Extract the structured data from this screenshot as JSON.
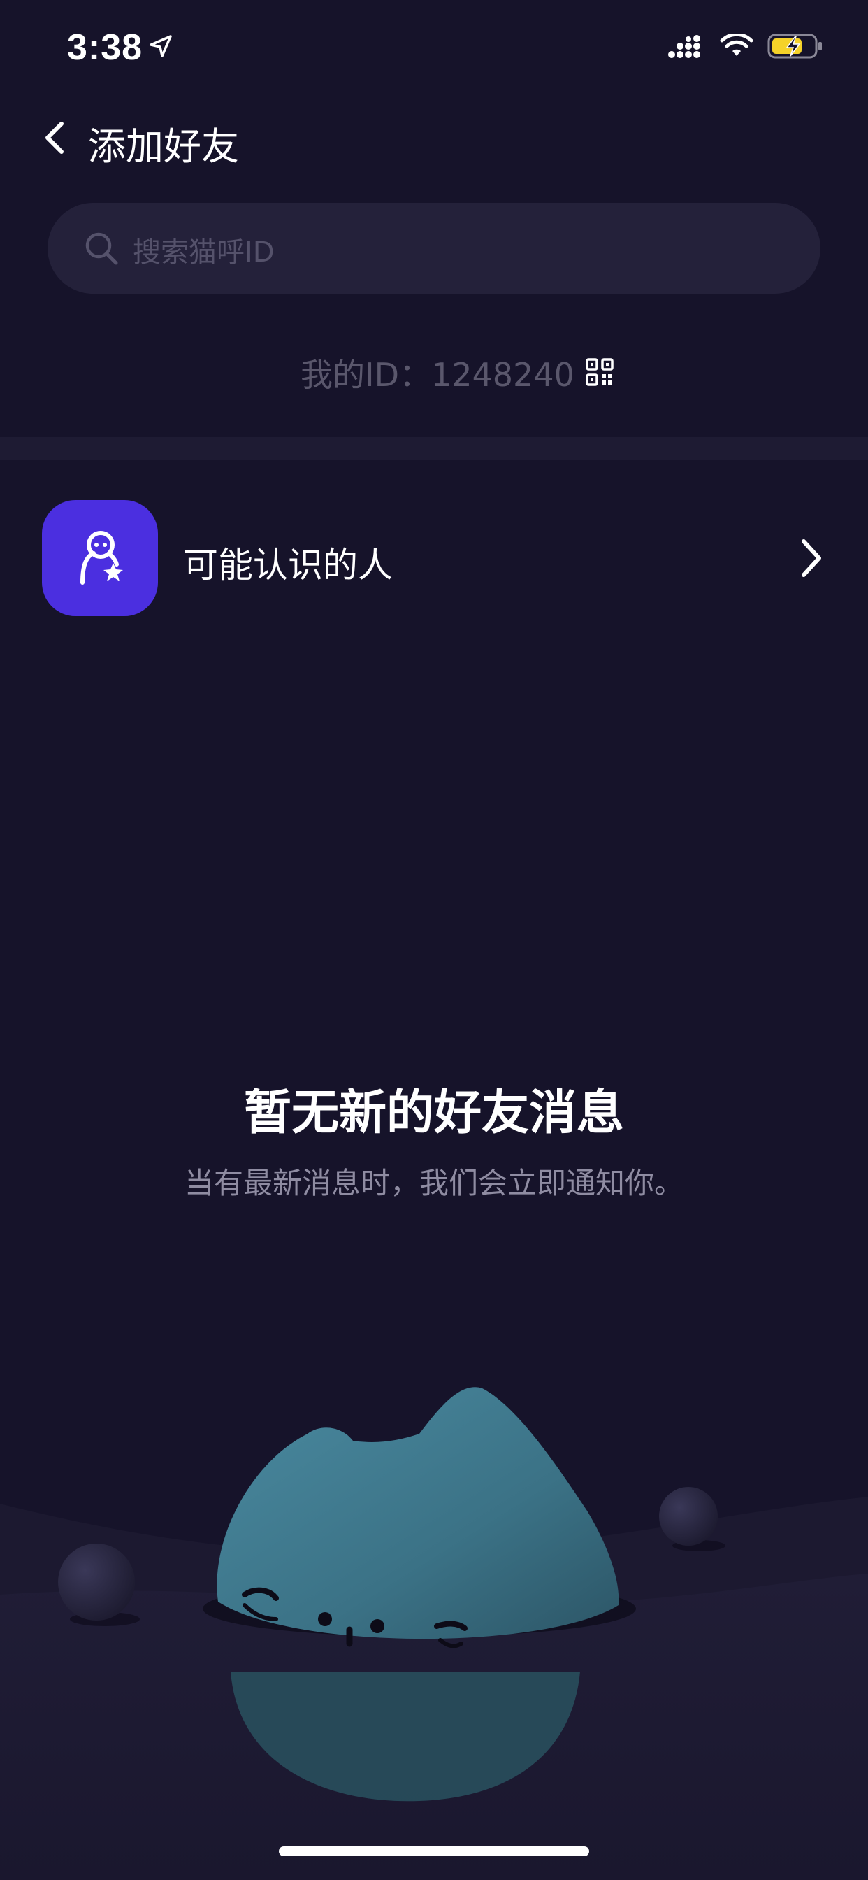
{
  "status_bar": {
    "time": "3:38",
    "icons": [
      "location-arrow-icon",
      "signal-icon",
      "wifi-icon",
      "battery-charging-icon"
    ],
    "battery_color": "#f5d229"
  },
  "nav": {
    "title": "添加好友",
    "back_icon": "chevron-left-icon"
  },
  "search": {
    "placeholder": "搜索猫呼ID",
    "icon": "search-icon"
  },
  "my_id": {
    "label": "我的ID：1248240",
    "icon": "qr-code-icon"
  },
  "suggestion": {
    "label": "可能认识的人",
    "icon": "person-star-icon",
    "accent": "#4b2fe0"
  },
  "empty_state": {
    "title": "暂无新的好友消息",
    "subtitle": "当有最新消息时，我们会立即通知你。",
    "illustration": "sleeping-cat-blob"
  },
  "colors": {
    "background": "#16132a",
    "search_bg": "#24213a",
    "divider": "#1e1b33"
  }
}
